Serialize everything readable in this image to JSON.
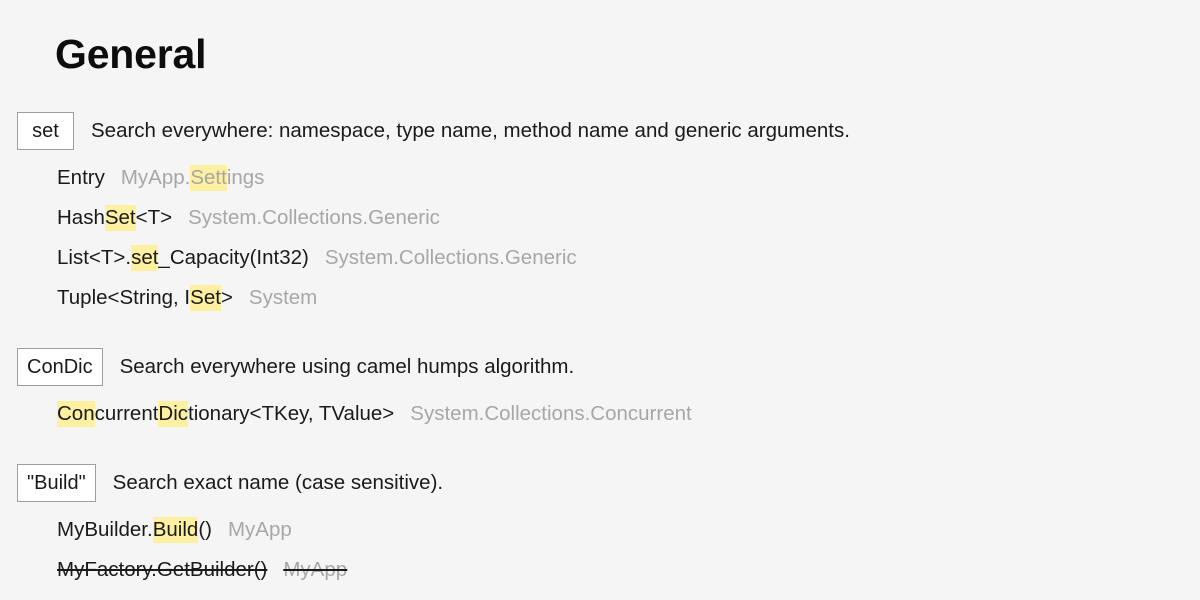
{
  "page": {
    "title": "General",
    "background_color": "#f5f5f5",
    "highlight_color": "#fdf0a0",
    "secondary_text_color": "#a9a6a9",
    "primary_text_color": "#1a1a1a"
  },
  "sections": [
    {
      "key": "set",
      "description": "Search everywhere: namespace, type name, method name and generic arguments.",
      "rows": [
        {
          "primary_plain": "Entry",
          "secondary_plain": "MyApp.Settings",
          "primary_parts": [
            {
              "text": "Entry",
              "highlight": false
            }
          ],
          "secondary_parts": [
            {
              "text": "MyApp.",
              "highlight": false
            },
            {
              "text": "Sett",
              "highlight": true
            },
            {
              "text": "ings",
              "highlight": false
            }
          ],
          "struck": false
        },
        {
          "primary_plain": "HashSet<T>",
          "secondary_plain": "System.Collections.Generic",
          "primary_parts": [
            {
              "text": "Hash",
              "highlight": false
            },
            {
              "text": "Set",
              "highlight": true
            },
            {
              "text": "<T>",
              "highlight": false
            }
          ],
          "secondary_parts": [
            {
              "text": "System.Collections.Generic",
              "highlight": false
            }
          ],
          "struck": false
        },
        {
          "primary_plain": "List<T>.set_Capacity(Int32)",
          "secondary_plain": "System.Collections.Generic",
          "primary_parts": [
            {
              "text": "List<T>.",
              "highlight": false
            },
            {
              "text": "set",
              "highlight": true
            },
            {
              "text": "_Capacity(Int32)",
              "highlight": false
            }
          ],
          "secondary_parts": [
            {
              "text": "System.Collections.Generic",
              "highlight": false
            }
          ],
          "struck": false
        },
        {
          "primary_plain": "Tuple<String, ISet>",
          "secondary_plain": "System",
          "primary_parts": [
            {
              "text": "Tuple<String, I",
              "highlight": false
            },
            {
              "text": "Set",
              "highlight": true
            },
            {
              "text": ">",
              "highlight": false
            }
          ],
          "secondary_parts": [
            {
              "text": "System",
              "highlight": false
            }
          ],
          "struck": false
        }
      ]
    },
    {
      "key": "ConDic",
      "description": "Search everywhere using camel humps algorithm.",
      "rows": [
        {
          "primary_plain": "ConcurrentDictionary<TKey, TValue>",
          "secondary_plain": "System.Collections.Concurrent",
          "primary_parts": [
            {
              "text": "Con",
              "highlight": true
            },
            {
              "text": "current",
              "highlight": false
            },
            {
              "text": "Dic",
              "highlight": true
            },
            {
              "text": "tionary<TKey, TValue>",
              "highlight": false
            }
          ],
          "secondary_parts": [
            {
              "text": "System.Collections.Concurrent",
              "highlight": false
            }
          ],
          "struck": false
        }
      ]
    },
    {
      "key": "\"Build\"",
      "description": "Search exact name (case sensitive).",
      "rows": [
        {
          "primary_plain": "MyBuilder.Build()",
          "secondary_plain": "MyApp",
          "primary_parts": [
            {
              "text": "MyBuilder.",
              "highlight": false
            },
            {
              "text": "Build",
              "highlight": true
            },
            {
              "text": "()",
              "highlight": false
            }
          ],
          "secondary_parts": [
            {
              "text": "MyApp",
              "highlight": false
            }
          ],
          "struck": false
        },
        {
          "primary_plain": "MyFactory.GetBuilder()",
          "secondary_plain": "MyApp",
          "primary_parts": [
            {
              "text": "MyFactory.GetBuilder()",
              "highlight": false
            }
          ],
          "secondary_parts": [
            {
              "text": "MyApp",
              "highlight": false
            }
          ],
          "struck": true
        }
      ]
    }
  ]
}
